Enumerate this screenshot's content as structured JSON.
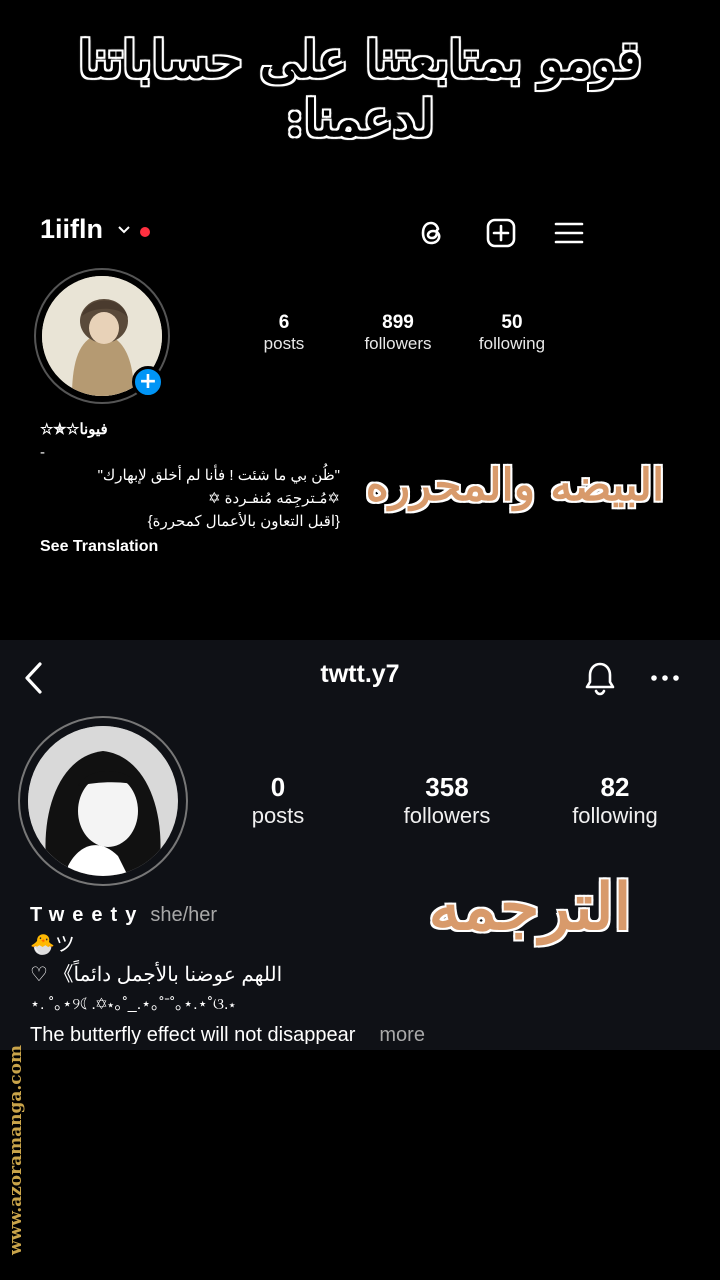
{
  "banner": {
    "text": "قومو بمتابعتنا على حساباتنا لدعمنا:"
  },
  "profile1": {
    "username": "1iifln",
    "icons": [
      "threads-icon",
      "add-post-icon",
      "menu-icon"
    ],
    "stats": [
      {
        "value": "6",
        "label": "posts"
      },
      {
        "value": "899",
        "label": "followers"
      },
      {
        "value": "50",
        "label": "following"
      }
    ],
    "bio": {
      "name": "☆✮☆فيونا",
      "dash": "-",
      "line1": "\"ظُن بي ما شئت ! فأنا لم أخلق لإبهارك\"",
      "line2": "✡مُـترجِمَه مُنفـردة ✡",
      "line3": "{اقبل التعاون بالأعمال كمحررة}",
      "see_translation": "See Translation"
    },
    "overlay": "البيضه والمحرره"
  },
  "profile2": {
    "username": "twtt.y7",
    "stats": [
      {
        "value": "0",
        "label": "posts"
      },
      {
        "value": "358",
        "label": "followers"
      },
      {
        "value": "82",
        "label": "following"
      }
    ],
    "bio": {
      "name": "Tweety",
      "pronouns": "she/her",
      "line1": "🐣ツ",
      "line2": "اللهم عوضنا بالأجمل دائماً》 ♡",
      "line3": "⋆. ˚｡⋆୨☾.✡⋆｡˚_.⋆｡˚ˉ˚｡⋆.⋆˚ଓ.⋆",
      "line4": "The butterfly effect will not disappear",
      "more": "more"
    },
    "overlay": "الترجمه"
  },
  "watermark": "www.azoramanga.com"
}
